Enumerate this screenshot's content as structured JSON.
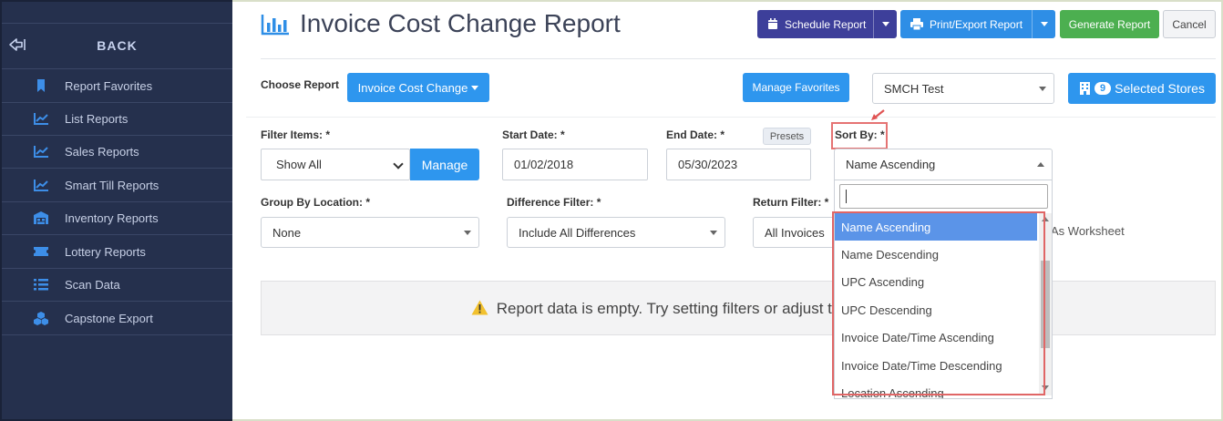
{
  "sidebar": {
    "back_label": "BACK",
    "items": [
      {
        "label": "Report Favorites",
        "icon": "bookmark-icon"
      },
      {
        "label": "List Reports",
        "icon": "trend-chart-icon"
      },
      {
        "label": "Sales Reports",
        "icon": "trend-chart-icon"
      },
      {
        "label": "Smart Till Reports",
        "icon": "trend-chart-icon"
      },
      {
        "label": "Inventory Reports",
        "icon": "warehouse-icon"
      },
      {
        "label": "Lottery Reports",
        "icon": "ticket-icon"
      },
      {
        "label": "Scan Data",
        "icon": "list-icon"
      },
      {
        "label": "Capstone Export",
        "icon": "cubes-icon"
      }
    ]
  },
  "header": {
    "title": "Invoice Cost Change Report",
    "schedule_label": "Schedule Report",
    "print_label": "Print/Export Report",
    "generate_label": "Generate Report",
    "cancel_label": "Cancel"
  },
  "report": {
    "choose_label": "Choose Report",
    "selected_report": "Invoice Cost Change",
    "favorites_label": "Manage Favorites",
    "store_group": "SMCH Test",
    "stores_count": "9",
    "stores_label": "Selected Stores"
  },
  "filters": {
    "filter_items_label": "Filter Items: *",
    "filter_items_value": "Show All",
    "manage_label": "Manage",
    "start_date_label": "Start Date: *",
    "start_date": "01/02/2018",
    "end_date_label": "End Date: *",
    "end_date": "05/30/2023",
    "presets_label": "Presets",
    "sort_by_label": "Sort By: *",
    "sort_by_value": "Name Ascending",
    "group_by_label": "Group By Location: *",
    "group_by_value": "None",
    "difference_label": "Difference Filter: *",
    "difference_value": "Include All Differences",
    "return_label": "Return Filter: *",
    "return_value": "All Invoices",
    "worksheet_label": "As Worksheet"
  },
  "empty_state": {
    "message": "Report data is empty. Try setting filters or adjust t"
  },
  "sort_dropdown": {
    "options": [
      "Name Ascending",
      "Name Descending",
      "UPC Ascending",
      "UPC Descending",
      "Invoice Date/Time Ascending",
      "Invoice Date/Time Descending",
      "Location Ascending"
    ]
  },
  "colors": {
    "sidebar_bg": "#25304d",
    "primary": "#2e96ee",
    "schedule": "#3d3f9a",
    "generate": "#4caf50",
    "highlight": "#e06666"
  }
}
